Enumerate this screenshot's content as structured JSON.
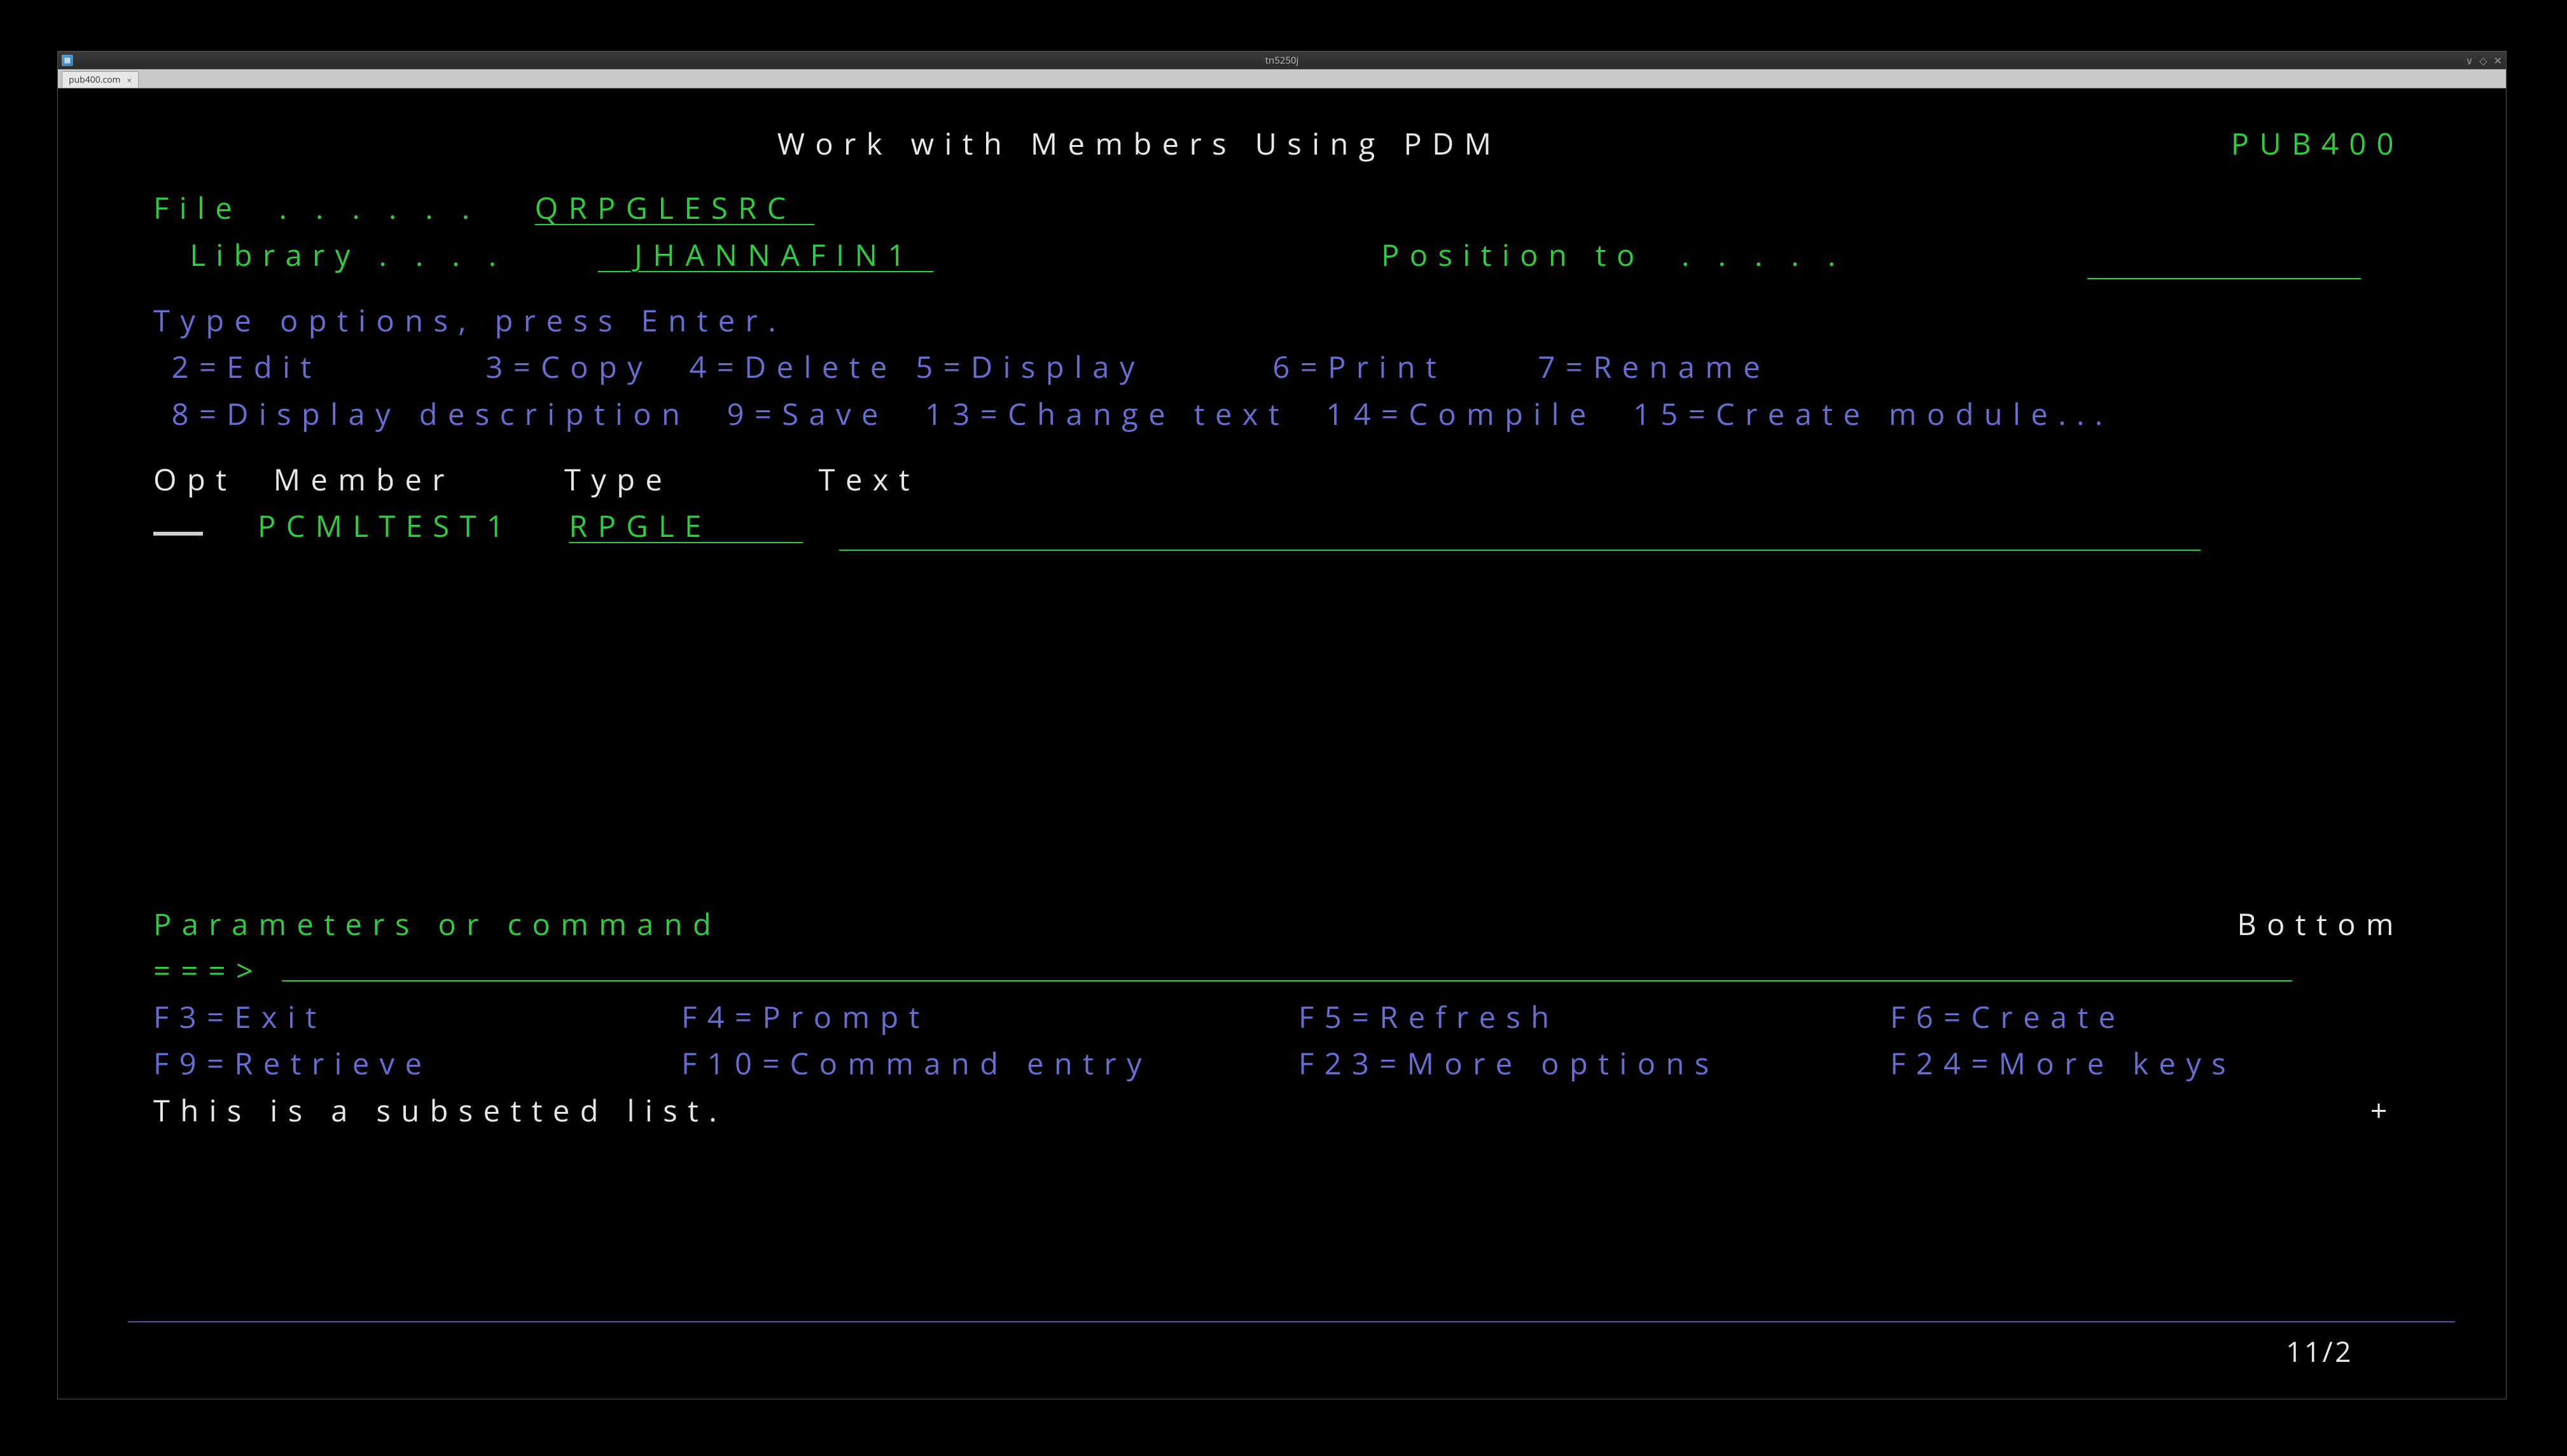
{
  "window": {
    "title": "tn5250j",
    "tab_label": "pub400.com",
    "min": "∨",
    "max": "◇",
    "close": "✕"
  },
  "screen": {
    "title": "Work with Members Using PDM",
    "system": "PUB400",
    "file_label": "File  . . . . . .",
    "file_value": "QRPGLESRC ",
    "library_label": "  Library . . . .",
    "library_value": "  JHANNAFIN1 ",
    "position_label": "Position to  . . . . .",
    "instr": "Type options, press Enter.",
    "opts_line1": " 2=Edit         3=Copy  4=Delete 5=Display       6=Print     7=Rename",
    "opts_line2": " 8=Display description  9=Save  13=Change text  14=Compile  15=Create module...",
    "col_opt": "Opt",
    "col_member": "Member",
    "col_type": "Type",
    "col_text": "Text",
    "rows": [
      {
        "opt": "",
        "member": "PCMLTEST1",
        "type": "RPGLE     ",
        "text": ""
      }
    ],
    "bottom": "Bottom",
    "param_label": "Parameters or command",
    "prompt": "===>",
    "fkeys1": {
      "f3": "F3=Exit",
      "f4": "F4=Prompt",
      "f5": "F5=Refresh",
      "f6": "F6=Create"
    },
    "fkeys2": {
      "f9": "F9=Retrieve",
      "f10": "F10=Command entry",
      "f23": "F23=More options",
      "f24": "F24=More keys"
    },
    "msg": "This is a subsetted list.",
    "plus": "+",
    "cursor": "11/2"
  }
}
